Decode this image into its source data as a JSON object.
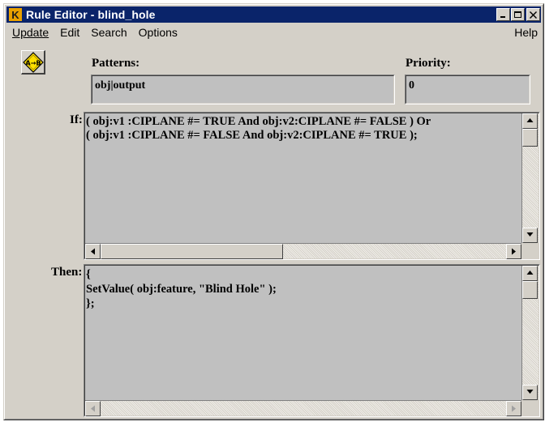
{
  "window": {
    "title": "Rule Editor - blind_hole",
    "app_icon_letter": "K"
  },
  "menu": {
    "items": [
      {
        "label": "Update"
      },
      {
        "label": "Edit"
      },
      {
        "label": "Search"
      },
      {
        "label": "Options"
      }
    ],
    "help": "Help"
  },
  "rule": {
    "icon": "a-implies-b-icon",
    "patterns_label": "Patterns:",
    "patterns_value": "obj|output",
    "priority_label": "Priority:",
    "priority_value": "0",
    "if_label": "If:",
    "if_lines": [
      "( obj:v1 :CIPLANE #= TRUE And obj:v2:CIPLANE #= FALSE ) Or",
      "( obj:v1 :CIPLANE #= FALSE And obj:v2:CIPLANE #= TRUE );"
    ],
    "then_label": "Then:",
    "then_lines": [
      "{",
      "SetValue( obj:feature, \"Blind Hole\" );",
      "};"
    ]
  },
  "colors": {
    "titlebar": "#0a246a",
    "window_face": "#d4d0c8",
    "field_bg": "#c0c0c0"
  }
}
